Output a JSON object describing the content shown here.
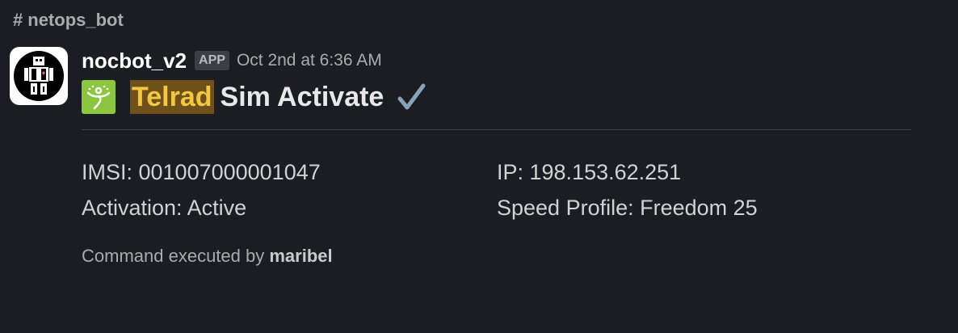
{
  "channel": {
    "prefix": "#",
    "name": "netops_bot"
  },
  "message": {
    "bot_name": "nocbot_v2",
    "app_badge": "APP",
    "timestamp": "Oct 2nd at 6:36 AM",
    "emoji_icon": "telrad-logo-icon",
    "title_highlight": "Telrad",
    "title_rest": "Sim Activate",
    "check_icon": "heavy-check-mark-icon",
    "fields": {
      "imsi": "IMSI: 001007000001047",
      "ip": "IP: 198.153.62.251",
      "activation": "Activation: Active",
      "speed_profile": "Speed Profile: Freedom 25"
    },
    "footer": {
      "prefix": "Command executed by",
      "user": "maribel"
    }
  },
  "colors": {
    "background": "#1a1d21",
    "highlight_bg": "#6e5019",
    "highlight_text": "#f2c744",
    "telrad_green": "#8cc63e"
  }
}
